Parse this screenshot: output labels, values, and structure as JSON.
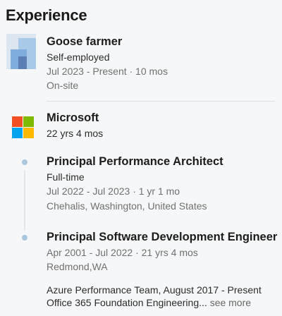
{
  "section": {
    "title": "Experience"
  },
  "goose": {
    "logo_icon": "company-logo-icon",
    "title": "Goose farmer",
    "employment": "Self-employed",
    "dates": "Jul 2023 - Present · 10 mos",
    "location": "On-site"
  },
  "microsoft": {
    "logo_icon": "microsoft-logo-icon",
    "company": "Microsoft",
    "tenure": "22 yrs 4 mos",
    "roles": [
      {
        "title": "Principal Performance Architect",
        "employment": "Full-time",
        "dates": "Jul 2022 - Jul 2023 · 1 yr 1 mo",
        "location": "Chehalis, Washington, United States"
      },
      {
        "title": "Principal Software Development Engineer",
        "dates": "Apr 2001 - Jul 2022 · 21 yrs 4 mos",
        "location": "Redmond,WA",
        "description_line1": "Azure Performance Team, August 2017 - Present",
        "description_line2": "Office 365 Foundation Engineering...",
        "see_more": "see more"
      }
    ]
  },
  "colors": {
    "ms_red": "#f25022",
    "ms_green": "#7fba00",
    "ms_blue": "#00a4ef",
    "ms_yellow": "#ffb900",
    "timeline_dot": "#a8c7df"
  }
}
